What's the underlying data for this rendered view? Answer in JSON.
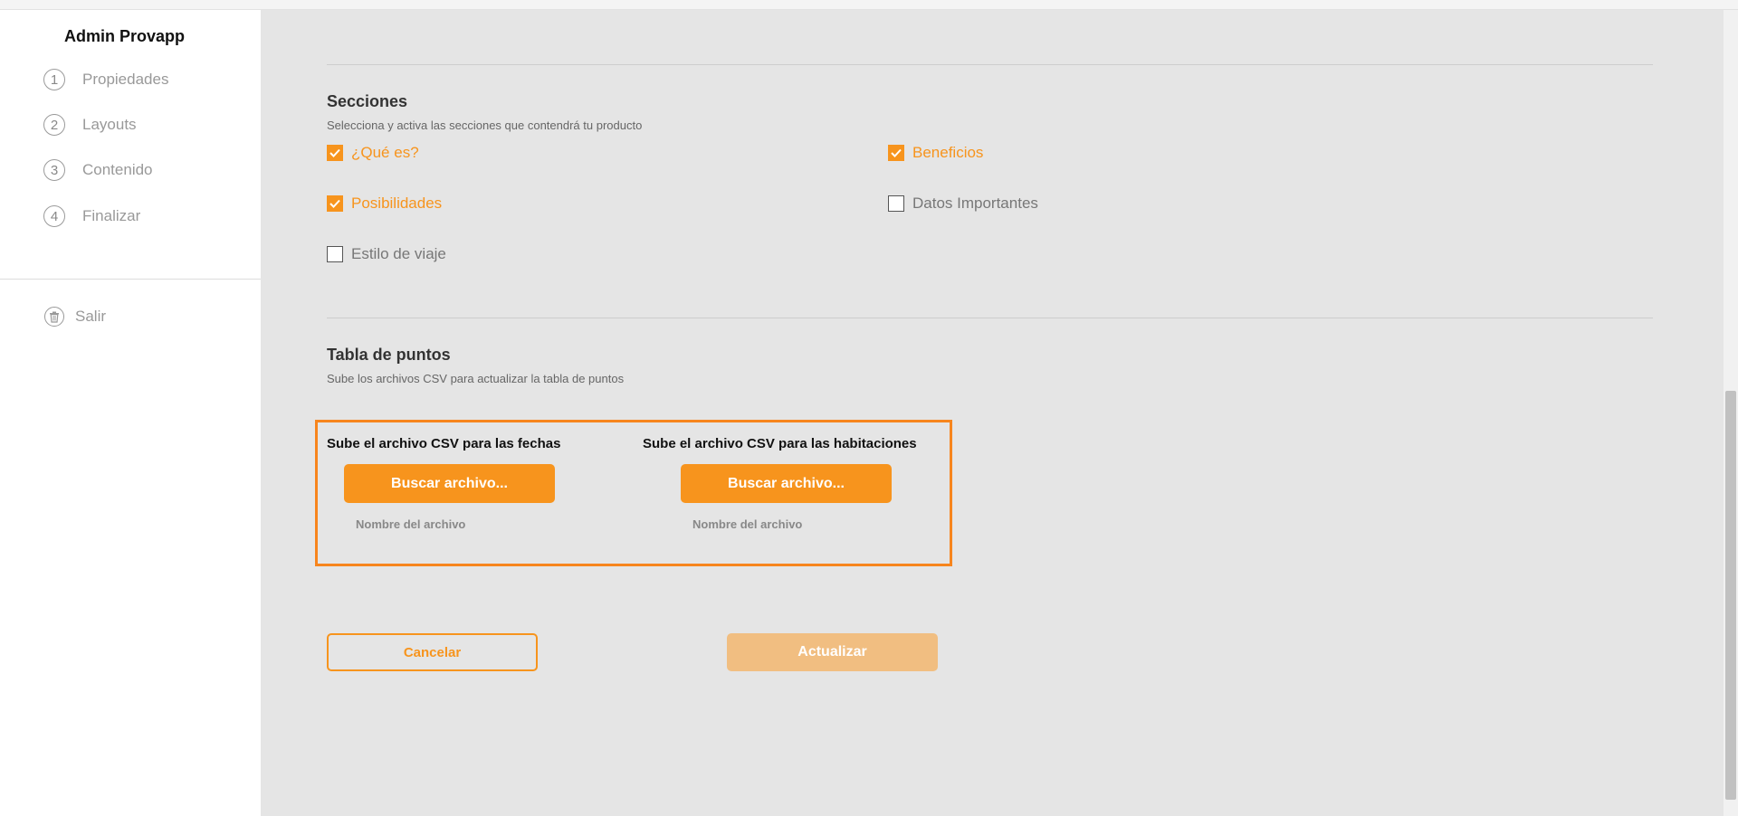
{
  "sidebar": {
    "brand": "Admin Provapp",
    "steps": [
      {
        "num": "1",
        "label": "Propiedades"
      },
      {
        "num": "2",
        "label": "Layouts"
      },
      {
        "num": "3",
        "label": "Contenido"
      },
      {
        "num": "4",
        "label": "Finalizar"
      }
    ],
    "logout_label": "Salir"
  },
  "sections": {
    "title": "Secciones",
    "subtitle": "Selecciona y activa las secciones que contendrá tu producto",
    "options": [
      {
        "label": "¿Qué es?",
        "checked": true
      },
      {
        "label": "Beneficios",
        "checked": true
      },
      {
        "label": "Posibilidades",
        "checked": true
      },
      {
        "label": "Datos Importantes",
        "checked": false
      },
      {
        "label": "Estilo de viaje",
        "checked": false
      }
    ]
  },
  "points_table": {
    "title": "Tabla de puntos",
    "subtitle": "Sube los archivos CSV para actualizar la tabla de puntos",
    "uploads": [
      {
        "title": "Sube el archivo CSV para las fechas",
        "button": "Buscar archivo...",
        "filename": "Nombre del archivo"
      },
      {
        "title": "Sube el archivo CSV para las habitaciones",
        "button": "Buscar archivo...",
        "filename": "Nombre del archivo"
      }
    ]
  },
  "actions": {
    "cancel_label": "Cancelar",
    "update_label": "Actualizar"
  },
  "colors": {
    "accent": "#f7941d",
    "accent_disabled": "#f1be81",
    "panel_bg": "#e5e5e5",
    "highlight_border": "#f7851d"
  }
}
